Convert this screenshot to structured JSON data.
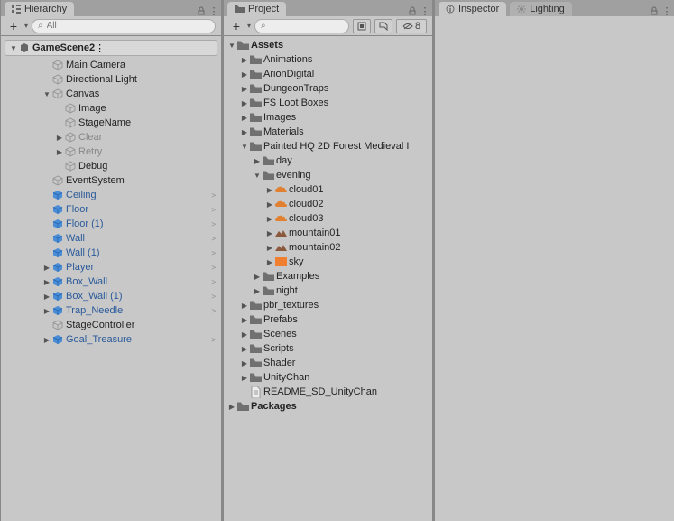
{
  "hierarchy": {
    "tab": "Hierarchy",
    "search_placeholder": "All",
    "scene": "GameScene2",
    "items": [
      {
        "label": "Main Camera",
        "indent": 1,
        "type": "cube"
      },
      {
        "label": "Directional Light",
        "indent": 1,
        "type": "cube"
      },
      {
        "label": "Canvas",
        "indent": 1,
        "type": "cube",
        "arrow": "down"
      },
      {
        "label": "Image",
        "indent": 2,
        "type": "cube"
      },
      {
        "label": "StageName",
        "indent": 2,
        "type": "cube"
      },
      {
        "label": "Clear",
        "indent": 2,
        "type": "cube",
        "arrow": "right",
        "disabled": true
      },
      {
        "label": "Retry",
        "indent": 2,
        "type": "cube",
        "arrow": "right",
        "disabled": true
      },
      {
        "label": "Debug",
        "indent": 2,
        "type": "cube"
      },
      {
        "label": "EventSystem",
        "indent": 1,
        "type": "cube"
      },
      {
        "label": "Ceiling",
        "indent": 1,
        "type": "prefab",
        "tail": ">"
      },
      {
        "label": "Floor",
        "indent": 1,
        "type": "prefab",
        "tail": ">"
      },
      {
        "label": "Floor (1)",
        "indent": 1,
        "type": "prefab",
        "tail": ">"
      },
      {
        "label": "Wall",
        "indent": 1,
        "type": "prefab",
        "tail": ">"
      },
      {
        "label": "Wall (1)",
        "indent": 1,
        "type": "prefab",
        "tail": ">"
      },
      {
        "label": "Player",
        "indent": 1,
        "type": "prefab",
        "arrow": "right",
        "tail": ">"
      },
      {
        "label": "Box_Wall",
        "indent": 1,
        "type": "prefab",
        "arrow": "right",
        "tail": ">"
      },
      {
        "label": "Box_Wall (1)",
        "indent": 1,
        "type": "prefab",
        "arrow": "right",
        "tail": ">"
      },
      {
        "label": "Trap_Needle",
        "indent": 1,
        "type": "prefab",
        "arrow": "right",
        "tail": ">"
      },
      {
        "label": "StageController",
        "indent": 1,
        "type": "cube"
      },
      {
        "label": "Goal_Treasure",
        "indent": 1,
        "type": "prefab",
        "arrow": "right",
        "tail": ">"
      }
    ]
  },
  "project": {
    "tab": "Project",
    "hidden_count": "8",
    "items": [
      {
        "label": "Assets",
        "indent": 0,
        "type": "folder",
        "arrow": "down",
        "bold": true
      },
      {
        "label": "Animations",
        "indent": 1,
        "type": "folder",
        "arrow": "right"
      },
      {
        "label": "ArionDigital",
        "indent": 1,
        "type": "folder",
        "arrow": "right"
      },
      {
        "label": "DungeonTraps",
        "indent": 1,
        "type": "folder",
        "arrow": "right"
      },
      {
        "label": "FS Loot Boxes",
        "indent": 1,
        "type": "folder",
        "arrow": "right"
      },
      {
        "label": "Images",
        "indent": 1,
        "type": "folder",
        "arrow": "right"
      },
      {
        "label": "Materials",
        "indent": 1,
        "type": "folder",
        "arrow": "right"
      },
      {
        "label": "Painted HQ 2D Forest Medieval I",
        "indent": 1,
        "type": "folder",
        "arrow": "down"
      },
      {
        "label": "day",
        "indent": 2,
        "type": "folder",
        "arrow": "right"
      },
      {
        "label": "evening",
        "indent": 2,
        "type": "folder",
        "arrow": "down"
      },
      {
        "label": "cloud01",
        "indent": 3,
        "type": "tex-cloud",
        "arrow": "right"
      },
      {
        "label": "cloud02",
        "indent": 3,
        "type": "tex-cloud",
        "arrow": "right"
      },
      {
        "label": "cloud03",
        "indent": 3,
        "type": "tex-cloud",
        "arrow": "right"
      },
      {
        "label": "mountain01",
        "indent": 3,
        "type": "tex-mtn",
        "arrow": "right"
      },
      {
        "label": "mountain02",
        "indent": 3,
        "type": "tex-mtn",
        "arrow": "right"
      },
      {
        "label": "sky",
        "indent": 3,
        "type": "tex-sky",
        "arrow": "right"
      },
      {
        "label": "Examples",
        "indent": 2,
        "type": "folder",
        "arrow": "right"
      },
      {
        "label": "night",
        "indent": 2,
        "type": "folder",
        "arrow": "right"
      },
      {
        "label": "pbr_textures",
        "indent": 1,
        "type": "folder",
        "arrow": "right"
      },
      {
        "label": "Prefabs",
        "indent": 1,
        "type": "folder",
        "arrow": "right"
      },
      {
        "label": "Scenes",
        "indent": 1,
        "type": "folder",
        "arrow": "right"
      },
      {
        "label": "Scripts",
        "indent": 1,
        "type": "folder",
        "arrow": "right"
      },
      {
        "label": "Shader",
        "indent": 1,
        "type": "folder",
        "arrow": "right"
      },
      {
        "label": "UnityChan",
        "indent": 1,
        "type": "folder",
        "arrow": "right"
      },
      {
        "label": "README_SD_UnityChan",
        "indent": 1,
        "type": "doc"
      },
      {
        "label": "Packages",
        "indent": 0,
        "type": "folder",
        "arrow": "right",
        "bold": true
      }
    ]
  },
  "inspector": {
    "tab": "Inspector"
  },
  "lighting": {
    "tab": "Lighting"
  }
}
